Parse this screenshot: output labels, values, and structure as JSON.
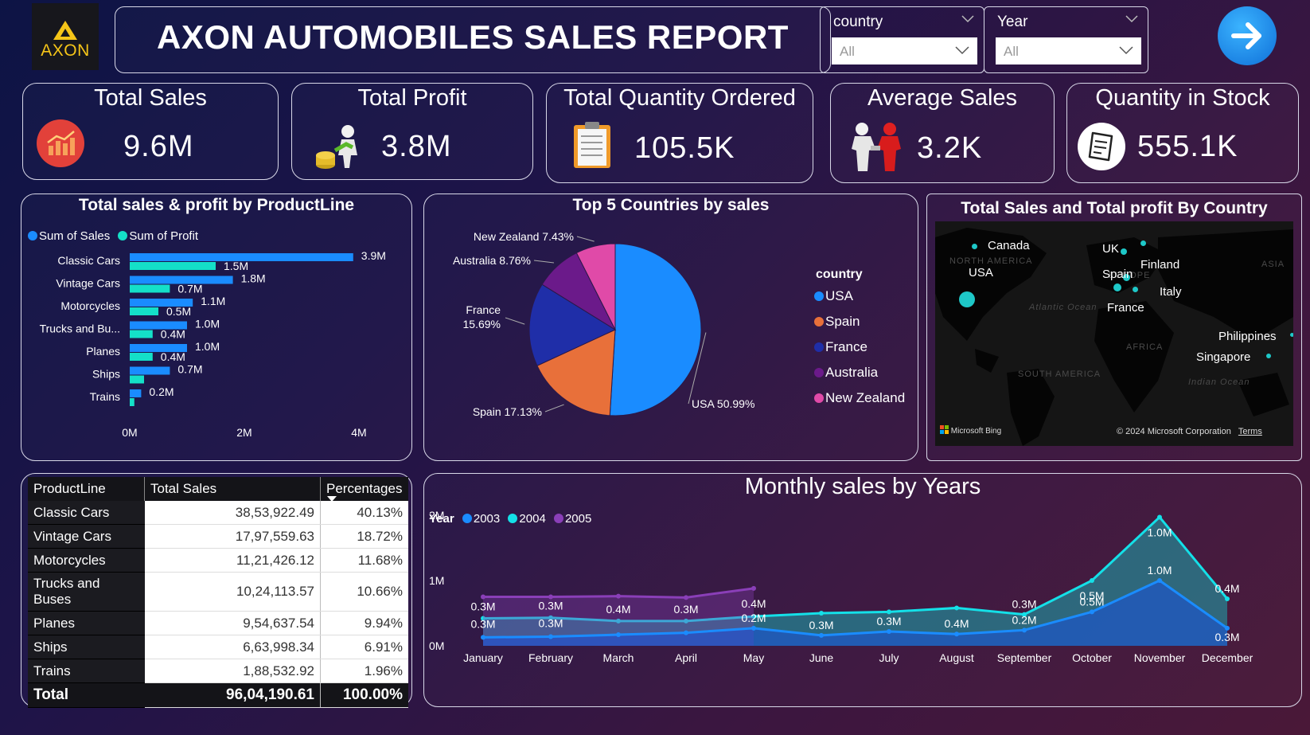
{
  "header": {
    "logo_text": "AXON",
    "title": "AXON AUTOMOBILES SALES REPORT",
    "filters": [
      {
        "label": "country",
        "value": "All"
      },
      {
        "label": "Year",
        "value": "All"
      }
    ],
    "nav_icon": "arrow-right-icon"
  },
  "kpis": [
    {
      "title": "Total Sales",
      "value": "9.6M",
      "icon": "sales-chart-icon"
    },
    {
      "title": "Total Profit",
      "value": "3.8M",
      "icon": "money-man-icon"
    },
    {
      "title": "Total Quantity Ordered",
      "value": "105.5K",
      "icon": "clipboard-icon"
    },
    {
      "title": "Average Sales",
      "value": "3.2K",
      "icon": "handshake-icon"
    },
    {
      "title": "Quantity in Stock",
      "value": "555.1K",
      "icon": "receipt-icon"
    }
  ],
  "colors": {
    "sales": "#1a8cff",
    "profit": "#14e0c8",
    "y2003": "#1a8cff",
    "y2004": "#14e0e8",
    "y2005": "#8a3fb8",
    "usa": "#1a8cff",
    "spain": "#e8703a",
    "france": "#1f2ea8",
    "australia": "#6b1a8a",
    "newzealand": "#e04aa8"
  },
  "chart_data": [
    {
      "type": "bar",
      "title": "Total sales & profit by ProductLine",
      "categories": [
        "Classic Cars",
        "Vintage Cars",
        "Motorcycles",
        "Trucks and Bu...",
        "Planes",
        "Ships",
        "Trains"
      ],
      "series": [
        {
          "name": "Sum of Sales",
          "values": [
            3.9,
            1.8,
            1.1,
            1.0,
            1.0,
            0.7,
            0.2
          ],
          "labels": [
            "3.9M",
            "1.8M",
            "1.1M",
            "1.0M",
            "1.0M",
            "0.7M",
            "0.2M"
          ]
        },
        {
          "name": "Sum of Profit",
          "values": [
            1.5,
            0.7,
            0.5,
            0.4,
            0.4,
            0.25,
            0.08
          ],
          "labels": [
            "1.5M",
            "0.7M",
            "0.5M",
            "0.4M",
            "0.4M",
            "",
            ""
          ]
        }
      ],
      "xticks": [
        "0M",
        "2M",
        "4M"
      ],
      "xlim": [
        0,
        4
      ]
    },
    {
      "type": "pie",
      "title": "Top 5 Countries by sales",
      "legend_title": "country",
      "slices": [
        {
          "name": "USA",
          "value": 50.99,
          "label": "USA 50.99%"
        },
        {
          "name": "Spain",
          "value": 17.13,
          "label": "Spain 17.13%"
        },
        {
          "name": "France",
          "value": 15.69,
          "label": "France 15.69%"
        },
        {
          "name": "Australia",
          "value": 8.76,
          "label": "Australia 8.76%"
        },
        {
          "name": "New Zealand",
          "value": 7.43,
          "label": "New Zealand 7.43%"
        }
      ]
    },
    {
      "type": "line",
      "title": "Monthly sales by Years",
      "legend_title": "Year",
      "categories": [
        "January",
        "February",
        "March",
        "April",
        "May",
        "June",
        "July",
        "August",
        "September",
        "October",
        "November",
        "December"
      ],
      "yticks": [
        "0M",
        "1M",
        "2M"
      ],
      "ylim": [
        0,
        2
      ],
      "series": [
        {
          "name": "2003",
          "values": [
            0.13,
            0.14,
            0.17,
            0.2,
            0.27,
            0.16,
            0.22,
            0.18,
            0.24,
            0.52,
            1.0,
            0.27
          ],
          "labels": [
            "0.3M",
            "0.3M",
            "",
            "",
            "0.2M",
            "0.3M",
            "0.3M",
            "0.4M",
            "0.2M",
            "0.5M",
            "1.0M",
            "0.3M"
          ]
        },
        {
          "name": "2004",
          "values": [
            0.42,
            0.43,
            0.38,
            0.38,
            0.45,
            0.5,
            0.52,
            0.58,
            0.48,
            1.0,
            1.97,
            0.72
          ],
          "labels": [
            "0.3M",
            "0.3M",
            "0.4M",
            "0.3M",
            "",
            "",
            "",
            "",
            "0.3M",
            "0.5M",
            "1.0M",
            "0.4M"
          ]
        },
        {
          "name": "2005",
          "values": [
            0.75,
            0.75,
            0.76,
            0.74,
            0.88
          ],
          "labels": [
            "",
            "",
            "",
            "",
            "0.4M"
          ]
        }
      ]
    }
  ],
  "map": {
    "title": "Total Sales and Total profit By Country",
    "labels": [
      "Canada",
      "USA",
      "UK",
      "Finland",
      "Spain",
      "Italy",
      "France",
      "Philippines",
      "Singapore"
    ],
    "regions": [
      "NORTH AMERICA",
      "EUROPE",
      "ASIA",
      "Atlantic Ocean",
      "AFRICA",
      "SOUTH AMERICA",
      "Indian Ocean"
    ],
    "footer_left": "Microsoft Bing",
    "footer_right": "© 2024 Microsoft Corporation",
    "terms": "Terms"
  },
  "table": {
    "headers": [
      "ProductLine",
      "Total Sales",
      "Percentages"
    ],
    "rows": [
      [
        "Classic Cars",
        "38,53,922.49",
        "40.13%"
      ],
      [
        "Vintage Cars",
        "17,97,559.63",
        "18.72%"
      ],
      [
        "Motorcycles",
        "11,21,426.12",
        "11.68%"
      ],
      [
        "Trucks and Buses",
        "10,24,113.57",
        "10.66%"
      ],
      [
        "Planes",
        "9,54,637.54",
        "9.94%"
      ],
      [
        "Ships",
        "6,63,998.34",
        "6.91%"
      ],
      [
        "Trains",
        "1,88,532.92",
        "1.96%"
      ]
    ],
    "total": [
      "Total",
      "96,04,190.61",
      "100.00%"
    ]
  }
}
